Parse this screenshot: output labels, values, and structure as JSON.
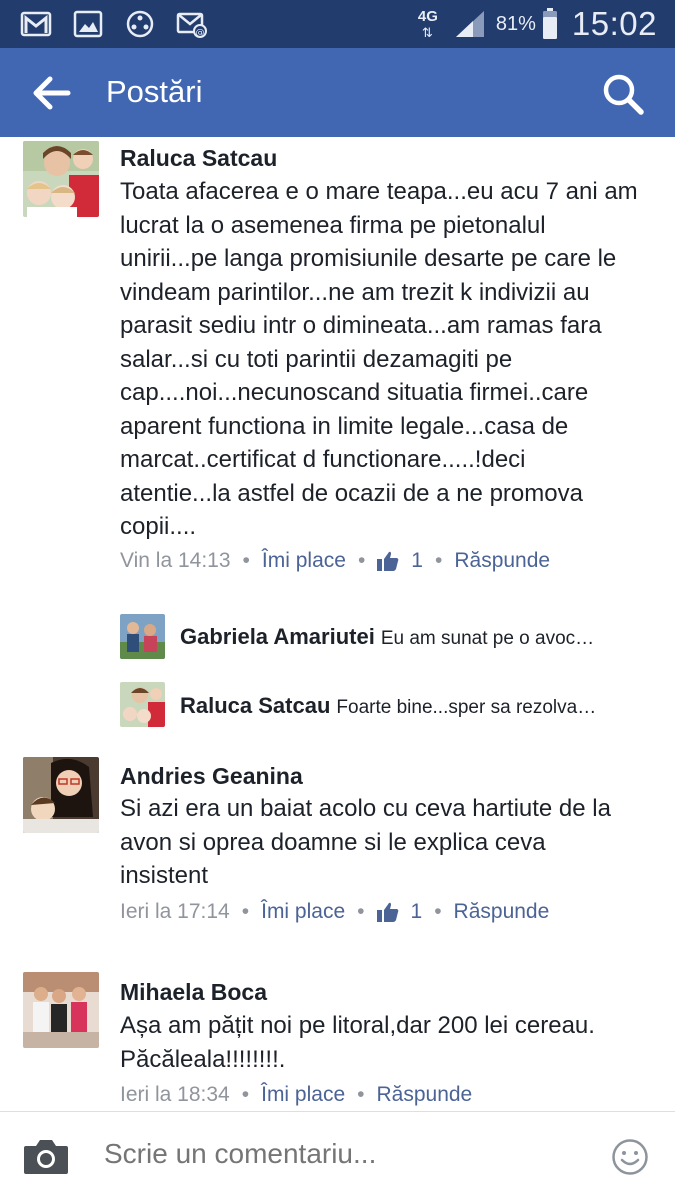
{
  "status_bar": {
    "network": "4G",
    "battery": "81%",
    "time": "15:02",
    "icons": [
      "gmail-icon",
      "gallery-icon",
      "game-icon",
      "mail-sync-icon"
    ]
  },
  "app_bar": {
    "title": "Postări",
    "back_icon": "arrow-left-icon",
    "search_icon": "search-icon"
  },
  "comments": [
    {
      "author": "Raluca Satcau",
      "text": "Toata afacerea e o mare teapa...eu acu 7 ani am lucrat la o asemenea firma pe pietonalul unirii...pe langa promisiunile desarte pe care le vindeam parintilor...ne am trezit k indivizii au parasit sediu intr o dimineata...am ramas fara salar...si cu toti parintii dezamagiti pe cap....noi...necunoscand situatia firmei..care aparent functiona in limite legale...casa de marcat..certificat d functionare.....!deci atentie...la astfel de ocazii de a ne promova copii....",
      "time": "Vin la 14:13",
      "like_label": "Îmi place",
      "like_count": "1",
      "reply_label": "Răspunde",
      "replies": [
        {
          "author": "Gabriela Amariutei",
          "text": "Eu am sunat pe o avoc…"
        },
        {
          "author": "Raluca Satcau",
          "text": "Foarte bine...sper sa rezolva…"
        }
      ]
    },
    {
      "author": "Andries Geanina",
      "text": "Si azi era un baiat  acolo cu ceva hartiute de la avon si oprea doamne si le explica ceva insistent",
      "time": "Ieri la 17:14",
      "like_label": "Îmi place",
      "like_count": "1",
      "reply_label": "Răspunde"
    },
    {
      "author": "Mihaela Boca",
      "text": "Așa am pățit noi pe litoral,dar 200 lei cereau. Păcăleala!!!!!!!!.",
      "time": "Ieri la 18:34",
      "like_label": "Îmi place",
      "reply_label": "Răspunde"
    }
  ],
  "composer": {
    "placeholder": "Scrie un comentariu...",
    "camera_icon": "camera-icon",
    "emoji_icon": "smiley-icon"
  },
  "colors": {
    "status_bar": "#233c6e",
    "app_bar": "#4267b2",
    "action_link": "#4b6395",
    "meta_gray": "#90949c"
  }
}
